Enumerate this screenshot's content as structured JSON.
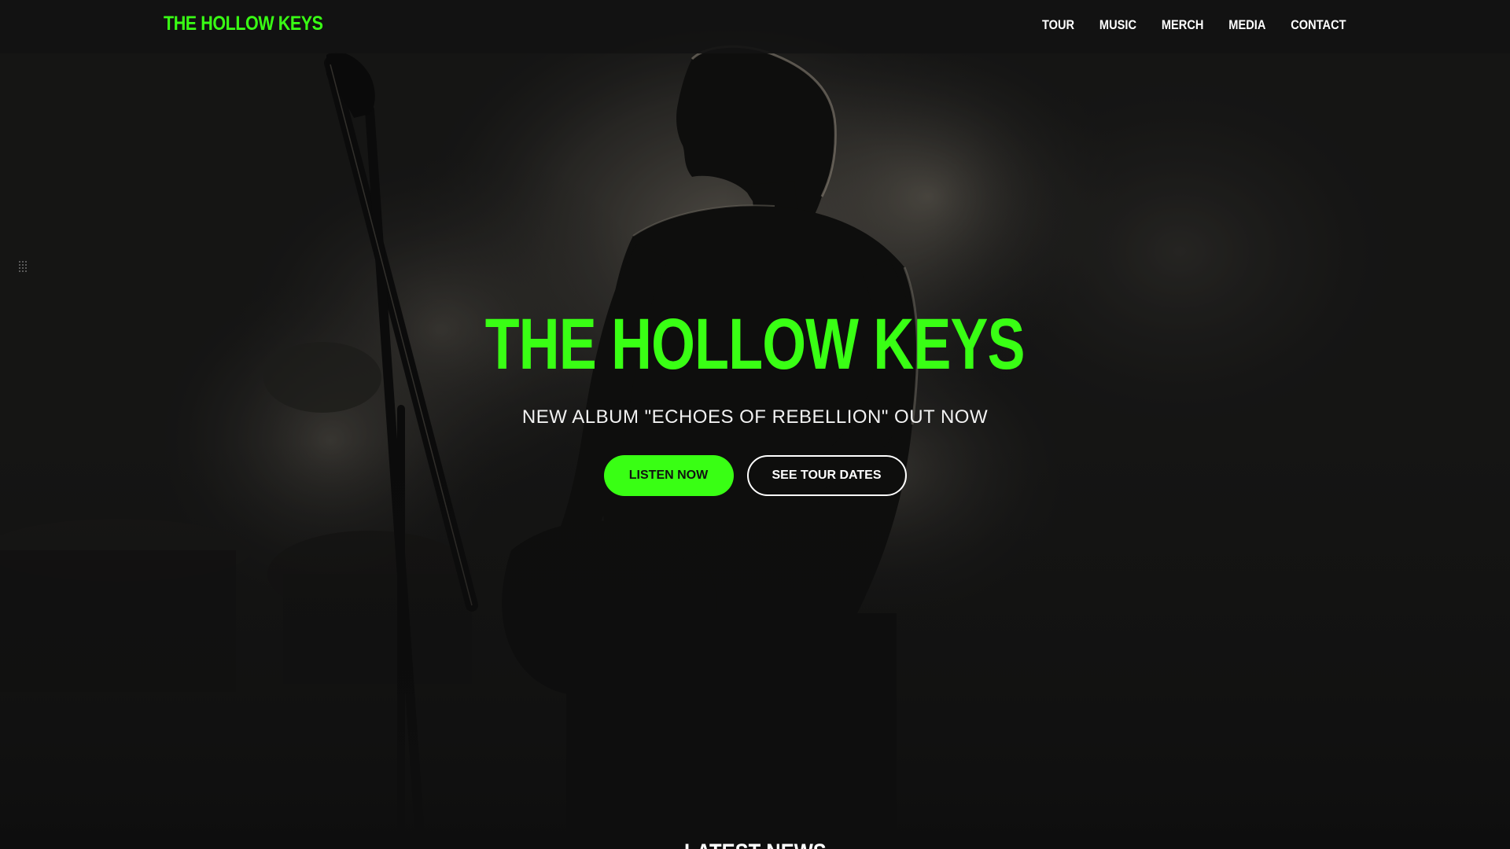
{
  "colors": {
    "accent": "#39ff14",
    "background": "#131313",
    "nav_background": "#121212",
    "text": "#ffffff"
  },
  "header": {
    "brand": "THE HOLLOW KEYS",
    "nav": [
      {
        "label": "TOUR"
      },
      {
        "label": "MUSIC"
      },
      {
        "label": "MERCH"
      },
      {
        "label": "MEDIA"
      },
      {
        "label": "CONTACT"
      }
    ]
  },
  "hero": {
    "title": "THE HOLLOW KEYS",
    "subtitle": "NEW ALBUM \"ECHOES OF REBELLION\" OUT NOW",
    "primary_button": "LISTEN NOW",
    "secondary_button": "SEE TOUR DATES"
  },
  "side_handle": {
    "icon": "grid-dots-icon"
  },
  "news": {
    "heading": "LATEST NEWS"
  }
}
